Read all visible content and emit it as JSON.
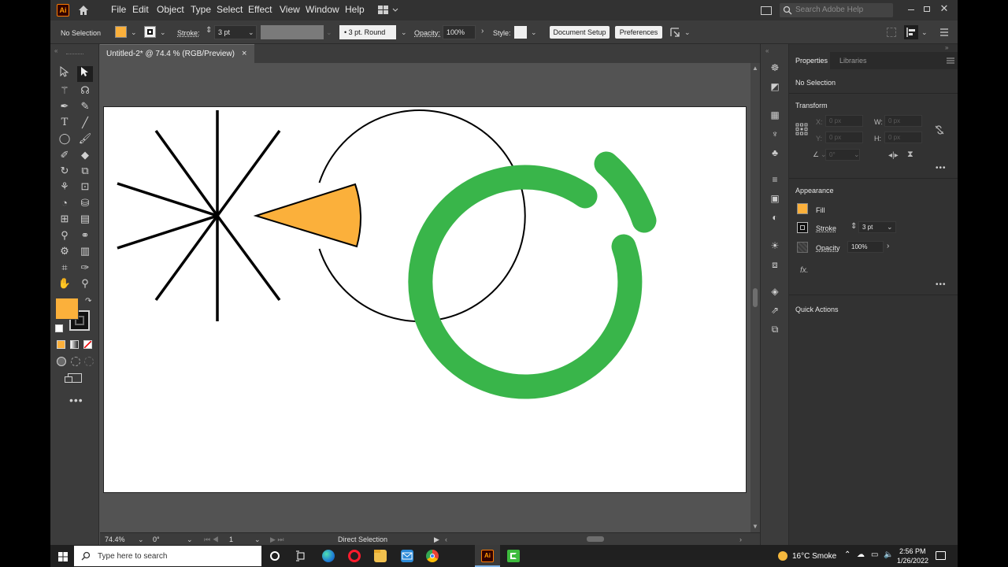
{
  "menubar": {
    "app_logo": "Ai",
    "items": [
      "File",
      "Edit",
      "Object",
      "Type",
      "Select",
      "Effect",
      "View",
      "Window",
      "Help"
    ],
    "search_placeholder": "Search Adobe Help"
  },
  "controlbar": {
    "selection": "No Selection",
    "stroke_label": "Stroke:",
    "stroke_value": "3 pt",
    "brush": "3 pt. Round",
    "opacity_label": "Opacity:",
    "opacity_value": "100%",
    "style_label": "Style:",
    "document_setup": "Document Setup",
    "preferences": "Preferences"
  },
  "document": {
    "tab_title": "Untitled-2* @ 74.4 % (RGB/Preview)",
    "close": "×"
  },
  "statusbar": {
    "zoom": "74.4%",
    "rotation": "0°",
    "artboard": "1",
    "tool": "Direct Selection"
  },
  "properties": {
    "tab_properties": "Properties",
    "tab_libraries": "Libraries",
    "selection": "No Selection",
    "transform_title": "Transform",
    "x_label": "X:",
    "x_value": "0 px",
    "y_label": "Y:",
    "y_value": "0 px",
    "w_label": "W:",
    "w_value": "0 px",
    "h_label": "H:",
    "h_value": "0 px",
    "angle_value": "0°",
    "appearance_title": "Appearance",
    "fill_label": "Fill",
    "stroke_label": "Stroke",
    "stroke_value": "3 pt",
    "opacity_label": "Opacity",
    "opacity_value": "100%",
    "fx_label": "fx.",
    "quick_actions_title": "Quick Actions"
  },
  "taskbar": {
    "search_placeholder": "Type here to search",
    "weather": "16°C  Smoke",
    "time": "2:56 PM",
    "date": "1/26/2022"
  },
  "colors": {
    "fill": "#FBB03B",
    "ring": "#39B54A",
    "ui_dark": "#323232",
    "ui_mid": "#3c3c3c",
    "canvas": "#535353"
  }
}
